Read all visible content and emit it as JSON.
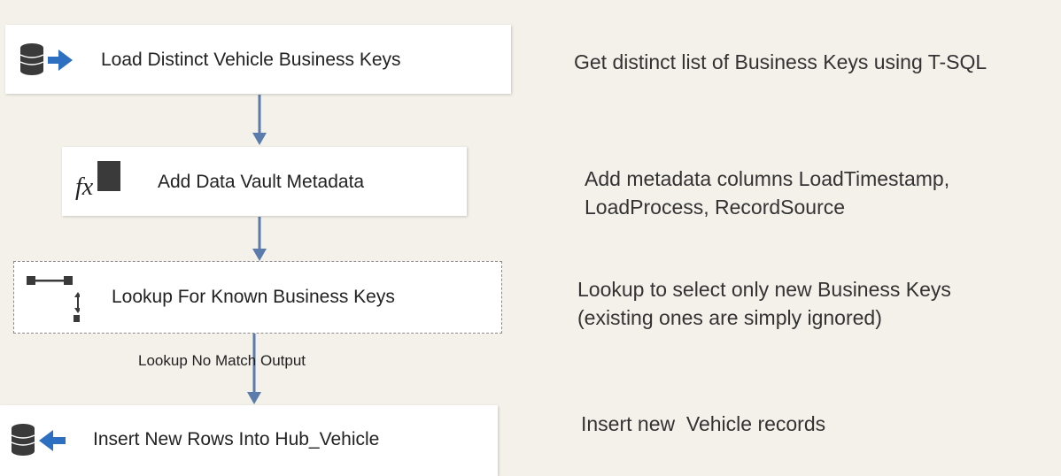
{
  "tasks": [
    {
      "label": "Load Distinct Vehicle Business Keys",
      "icon": "ole-db-source-icon"
    },
    {
      "label": "Add Data Vault Metadata",
      "icon": "derived-column-icon"
    },
    {
      "label": "Lookup For Known Business Keys",
      "icon": "lookup-icon"
    },
    {
      "label": "Insert New Rows Into Hub_Vehicle",
      "icon": "ole-db-destination-icon"
    }
  ],
  "notes": [
    {
      "line1": "Get distinct list of Business Keys using T-SQL"
    },
    {
      "line1": "Add metadata columns LoadTimestamp,",
      "line2": "LoadProcess, RecordSource"
    },
    {
      "line1": "Lookup to select only new Business Keys",
      "line2": "(existing ones are simply ignored)"
    },
    {
      "line1": "Insert new  Vehicle records"
    }
  ],
  "paths": {
    "lookup_output_label": "Lookup No Match Output"
  },
  "colors": {
    "canvas": "#f4f1ea",
    "connector": "#5a7bab",
    "db_icon": "#3a3a3a",
    "arrow_icon": "#2d6fc0"
  }
}
